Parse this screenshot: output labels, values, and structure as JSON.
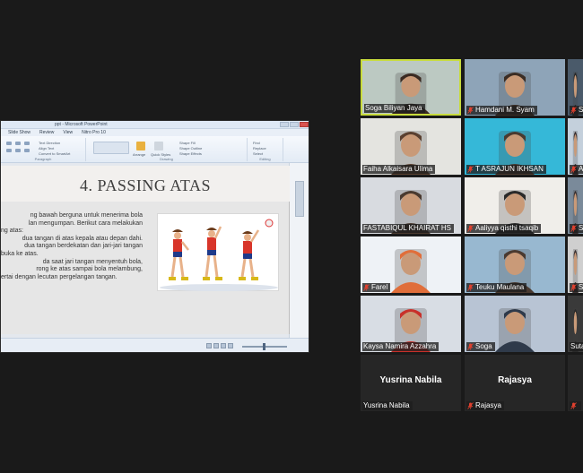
{
  "share": {
    "window_title": "ppt - Microsoft PowerPoint",
    "tabs": [
      "Slide Show",
      "Review",
      "View",
      "Nitro Pro 10"
    ],
    "ribbon": {
      "groups": [
        "Paragraph",
        "Drawing",
        "Editing"
      ],
      "items": [
        "Text Direction",
        "Align Text",
        "Convert to SmartArt",
        "Arrange",
        "Quick Styles",
        "Shape Fill",
        "Shape Outline",
        "Shape Effects",
        "Find",
        "Replace",
        "Select"
      ]
    },
    "slide": {
      "title": "4. PASSING ATAS",
      "lines": [
        "ng bawah berguna untuk menerima bola",
        "lan mengumpan. Berikut cara melakukan",
        "ng atas:",
        "dua tangan di atas kepala atau depan dahi.",
        "dua tangan berdekatan dan jari-jari tangan",
        "buka ke atas.",
        "da saat jari tangan menyentuh bola,",
        "rong ke atas sampai bola melambung,",
        "ertai dengan lecutan pergelangan tangan."
      ]
    }
  },
  "participants": [
    {
      "name": "Soga Biliyan Jaya",
      "muted": false,
      "video": true,
      "active": true
    },
    {
      "name": "Hamdani M. Syam",
      "muted": true,
      "video": true,
      "active": false
    },
    {
      "name": "S",
      "muted": true,
      "video": true,
      "active": false
    },
    {
      "name": "Faiha Alkaisara Ulima",
      "muted": false,
      "video": true,
      "active": false
    },
    {
      "name": "T ASRAJUN IKHSAN",
      "muted": true,
      "video": true,
      "active": false
    },
    {
      "name": "A",
      "muted": true,
      "video": true,
      "active": false
    },
    {
      "name": "FASTABIQUL KHAIRAT HS",
      "muted": false,
      "video": true,
      "active": false
    },
    {
      "name": "Aaliyya qisthi tsaqib",
      "muted": true,
      "video": true,
      "active": false
    },
    {
      "name": "S",
      "muted": true,
      "video": true,
      "active": false
    },
    {
      "name": "Farel",
      "muted": true,
      "video": true,
      "active": false
    },
    {
      "name": "Teuku Maulana",
      "muted": true,
      "video": true,
      "active": false
    },
    {
      "name": "S",
      "muted": true,
      "video": true,
      "active": false
    },
    {
      "name": "Kaysa Namira Azzahra",
      "muted": false,
      "video": true,
      "active": false
    },
    {
      "name": "Soga",
      "muted": true,
      "video": true,
      "active": false
    },
    {
      "name": "Suta",
      "muted": false,
      "video": true,
      "active": false
    },
    {
      "name": "Yusrina Nabila",
      "muted": false,
      "video": false,
      "active": false,
      "display_name": "Yusrina Nabila"
    },
    {
      "name": "Rajasya",
      "muted": true,
      "video": false,
      "active": false,
      "display_name": "Rajasya"
    },
    {
      "name": "",
      "muted": true,
      "video": false,
      "active": false
    }
  ],
  "colors": {
    "background": "#1a1a1a",
    "active_speaker_border": "#c8dc3c",
    "muted_icon": "#e0402e"
  }
}
